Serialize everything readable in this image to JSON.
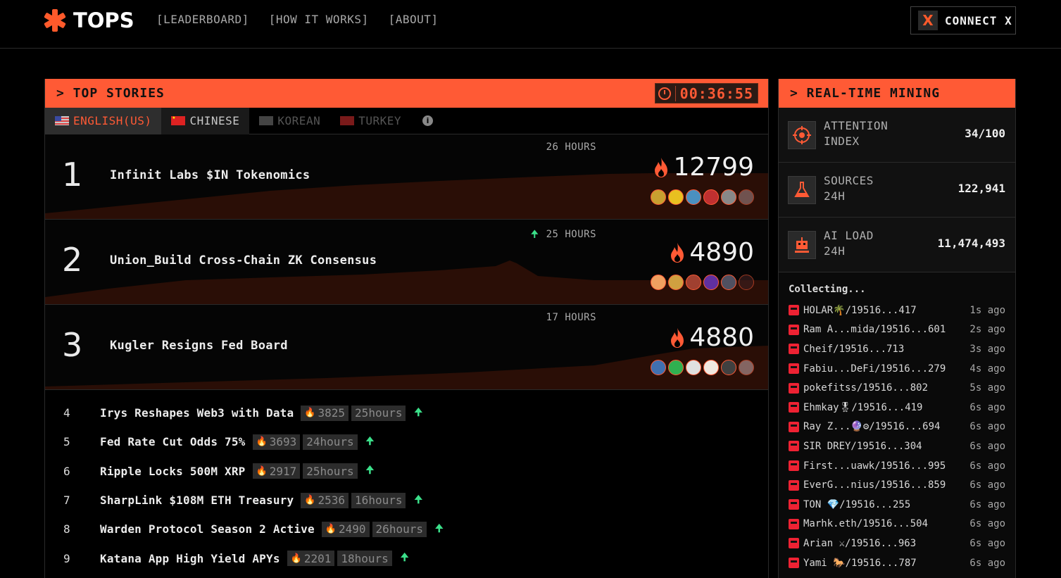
{
  "header": {
    "brand": "TOPS",
    "nav": [
      "[LEADERBOARD]",
      "[HOW IT WORKS]",
      "[ABOUT]"
    ],
    "connect_label": "CONNECT X"
  },
  "stories": {
    "title": "> TOP STORIES",
    "timer": "00:36:55",
    "tabs": [
      "ENGLISH(US)",
      "CHINESE",
      "KOREAN",
      "TURKEY"
    ],
    "featured": [
      {
        "rank": "1",
        "title": "Infinit Labs $IN Tokenomics",
        "hours": "26 HOURS",
        "score": "12799",
        "trending": false
      },
      {
        "rank": "2",
        "title": "Union_Build Cross-Chain ZK Consensus",
        "hours": "25 HOURS",
        "score": "4890",
        "trending": true
      },
      {
        "rank": "3",
        "title": "Kugler Resigns Fed Board",
        "hours": "17 HOURS",
        "score": "4880",
        "trending": false
      }
    ],
    "list": [
      {
        "rank": "4",
        "title": "Irys Reshapes Web3 with Data",
        "score": "3825",
        "age": "25hours"
      },
      {
        "rank": "5",
        "title": "Fed Rate Cut Odds 75%",
        "score": "3693",
        "age": "24hours"
      },
      {
        "rank": "6",
        "title": "Ripple Locks 500M XRP",
        "score": "2917",
        "age": "25hours"
      },
      {
        "rank": "7",
        "title": "SharpLink $108M ETH Treasury",
        "score": "2536",
        "age": "16hours"
      },
      {
        "rank": "8",
        "title": "Warden Protocol Season 2 Active",
        "score": "2490",
        "age": "26hours"
      },
      {
        "rank": "9",
        "title": "Katana App High Yield APYs",
        "score": "2201",
        "age": "18hours"
      }
    ]
  },
  "mining": {
    "title": "> REAL-TIME MINING",
    "stats": [
      {
        "label": "ATTENTION\nINDEX",
        "value": "34/100",
        "icon": "target-icon"
      },
      {
        "label": "SOURCES\n24H",
        "value": "122,941",
        "icon": "flask-icon"
      },
      {
        "label": "AI LOAD\n24H",
        "value": "11,474,493",
        "icon": "robot-icon"
      }
    ],
    "collecting_label": "Collecting...",
    "feed": [
      {
        "name": "HOLAR🌴/19516...417",
        "ago": "1s ago"
      },
      {
        "name": "Ram A...mida/19516...601",
        "ago": "2s ago"
      },
      {
        "name": "Cheif/19516...713",
        "ago": "3s ago"
      },
      {
        "name": "Fabiu...DeFi/19516...279",
        "ago": "4s ago"
      },
      {
        "name": "pokefitss/19516...802",
        "ago": "5s ago"
      },
      {
        "name": "Ehmkay🎖/19516...419",
        "ago": "6s ago"
      },
      {
        "name": "Ray Z...🔮⚙/19516...694",
        "ago": "6s ago"
      },
      {
        "name": "SIR DREY/19516...304",
        "ago": "6s ago"
      },
      {
        "name": "First...uawk/19516...995",
        "ago": "6s ago"
      },
      {
        "name": "EverG...nius/19516...859",
        "ago": "6s ago"
      },
      {
        "name": "TON 💎/19516...255",
        "ago": "6s ago"
      },
      {
        "name": "Marhk.eth/19516...504",
        "ago": "6s ago"
      },
      {
        "name": "Arian ⚔/19516...963",
        "ago": "6s ago"
      },
      {
        "name": "Yami 🐎/19516...787",
        "ago": "6s ago"
      }
    ]
  },
  "colors": {
    "accent": "#ff5a35",
    "up": "#3be08a"
  }
}
